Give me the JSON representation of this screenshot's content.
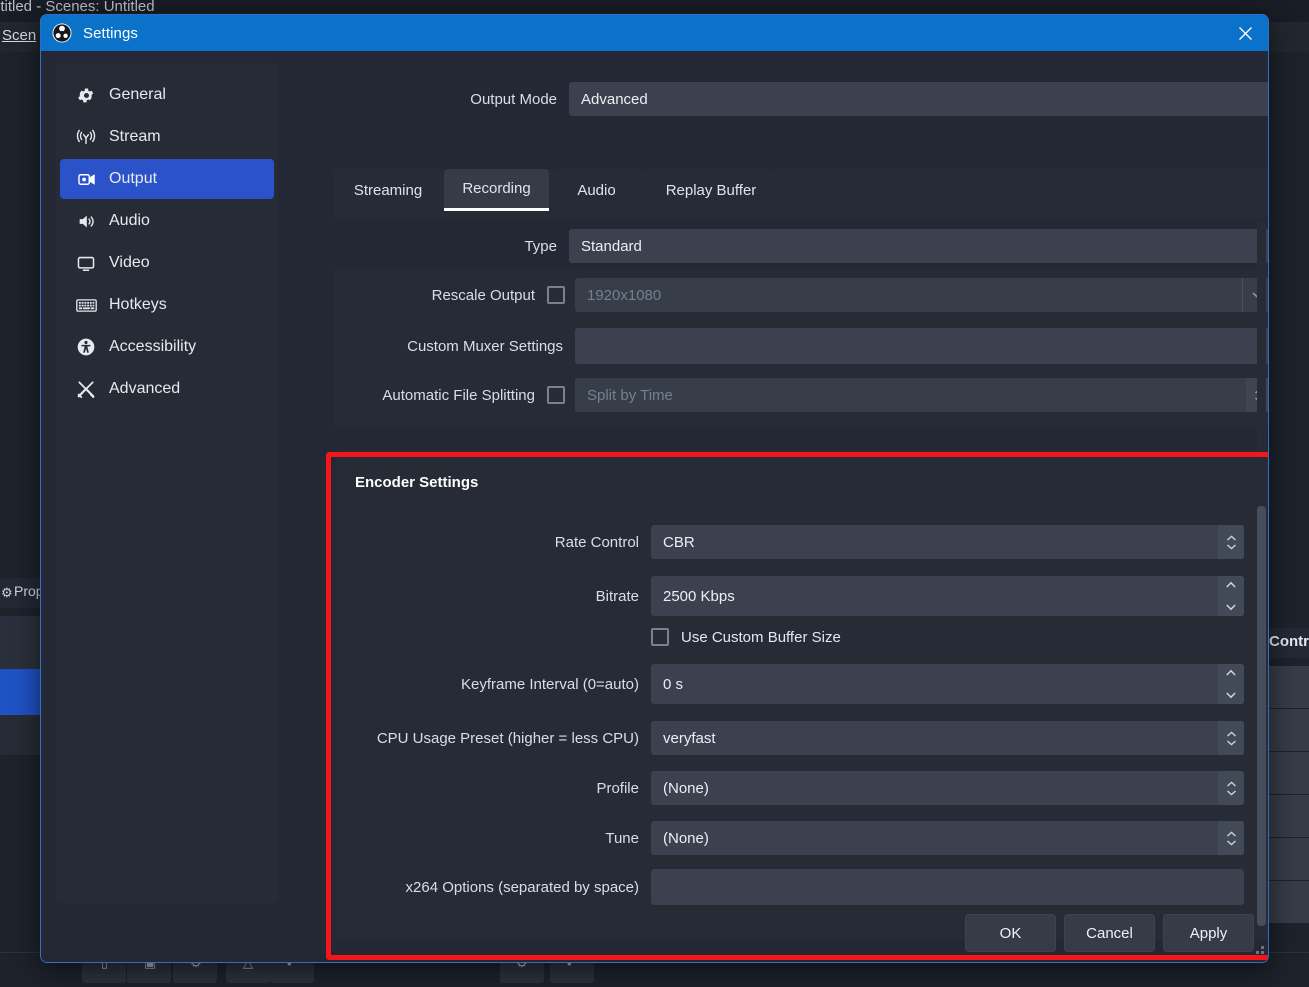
{
  "background": {
    "window_title": "ntitled - Scenes: Untitled",
    "menu_item": "Scen",
    "properties_label": "Prop",
    "properties_icon": "gear-icon",
    "controls_label": "Contr"
  },
  "dialog": {
    "title": "Settings",
    "logo_icon": "obs-logo-icon",
    "close_icon": "close-icon",
    "accent_blue": "#0a72c8",
    "border_blue": "#2f6fc4",
    "highlight_color": "#f5161b"
  },
  "sidebar": {
    "items": [
      {
        "label": "General",
        "icon": "gear-icon",
        "active": false
      },
      {
        "label": "Stream",
        "icon": "broadcast-icon",
        "active": false
      },
      {
        "label": "Output",
        "icon": "camera-icon",
        "active": true
      },
      {
        "label": "Audio",
        "icon": "speaker-icon",
        "active": false
      },
      {
        "label": "Video",
        "icon": "monitor-icon",
        "active": false
      },
      {
        "label": "Hotkeys",
        "icon": "keyboard-icon",
        "active": false
      },
      {
        "label": "Accessibility",
        "icon": "accessibility-icon",
        "active": false
      },
      {
        "label": "Advanced",
        "icon": "tools-icon",
        "active": false
      }
    ],
    "selected_bg": "#2b52c8"
  },
  "output_mode": {
    "label": "Output Mode",
    "value": "Advanced"
  },
  "tabs": [
    {
      "label": "Streaming",
      "active": false
    },
    {
      "label": "Recording",
      "active": true
    },
    {
      "label": "Audio",
      "active": false
    },
    {
      "label": "Replay Buffer",
      "active": false
    }
  ],
  "recording": {
    "type": {
      "label": "Type",
      "value": "Standard"
    },
    "rescale_output": {
      "label": "Rescale Output",
      "checked": false,
      "value": "1920x1080",
      "disabled": true
    },
    "custom_muxer": {
      "label": "Custom Muxer Settings",
      "value": "",
      "placeholder": ""
    },
    "auto_file_splitting": {
      "label": "Automatic File Splitting",
      "checked": false,
      "value": "Split by Time",
      "disabled": true
    }
  },
  "encoder_settings": {
    "title": "Encoder Settings",
    "fields": [
      {
        "label": "Rate Control",
        "value": "CBR",
        "control": "combobox"
      },
      {
        "label": "Bitrate",
        "value": "2500 Kbps",
        "control": "spinbox"
      },
      {
        "label": "Use Custom Buffer Size",
        "value": "",
        "control": "checkbox",
        "checked": false
      },
      {
        "label": "Keyframe Interval (0=auto)",
        "value": "0 s",
        "control": "spinbox"
      },
      {
        "label": "CPU Usage Preset (higher = less CPU)",
        "value": "veryfast",
        "control": "combobox"
      },
      {
        "label": "Profile",
        "value": "(None)",
        "control": "combobox"
      },
      {
        "label": "Tune",
        "value": "(None)",
        "control": "combobox"
      },
      {
        "label": "x264 Options (separated by space)",
        "value": "",
        "control": "textbox"
      }
    ]
  },
  "footer": {
    "ok": "OK",
    "cancel": "Cancel",
    "apply": "Apply"
  }
}
